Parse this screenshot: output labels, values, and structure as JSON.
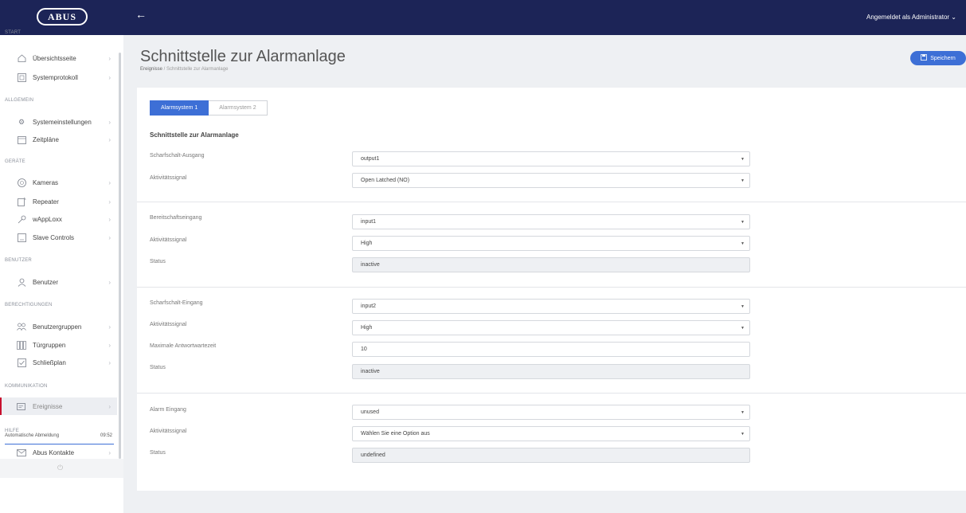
{
  "header": {
    "logo_text": "ABUS",
    "user_label": "Angemeldet als Administrator",
    "back_icon": "arrow-left-icon"
  },
  "sidebar": {
    "sections": {
      "start": "START",
      "allgemein": "ALLGEMEIN",
      "geraete": "GERÄTE",
      "benutzer": "BENUTZER",
      "berechtigungen": "BERECHTIGUNGEN",
      "kommunikation": "KOMMUNIKATION",
      "hilfe": "HILFE"
    },
    "items": {
      "uebersicht": "Übersichtsseite",
      "systemprotokoll": "Systemprotokoll",
      "systemeinstellungen": "Systemeinstellungen",
      "zeitplaene": "Zeitpläne",
      "kameras": "Kameras",
      "repeater": "Repeater",
      "wapploxx": "wAppLoxx",
      "slave_controls": "Slave Controls",
      "benutzer": "Benutzer",
      "benutzergruppen": "Benutzergruppen",
      "tuergruppen": "Türgruppen",
      "schliessplan": "Schließplan",
      "ereignisse": "Ereignisse",
      "abus_kontakte": "Abus Kontakte"
    },
    "autologout": {
      "label": "Automatische Abmeldung",
      "time": "09:52"
    }
  },
  "page": {
    "title": "Schnittstelle zur Alarmanlage",
    "breadcrumb_root": "Ereignisse",
    "breadcrumb_sep": " / ",
    "breadcrumb_current": "Schnittstelle zur Alarmanlage",
    "save_label": "Speichern"
  },
  "tabs": [
    "Alarmsystem 1",
    "Alarmsystem 2"
  ],
  "section_title": "Schnittstelle zur Alarmanlage",
  "groups": [
    {
      "label1": "Scharfschalt-Ausgang",
      "value1": "output1",
      "label2": "Aktivitätssignal",
      "value2": "Open Latched (NO)"
    },
    {
      "label1": "Bereitschaftseingang",
      "value1": "input1",
      "label2": "Aktivitätssignal",
      "value2": "High",
      "label3": "Status",
      "value3": "inactive"
    },
    {
      "label1": "Scharfschalt-Eingang",
      "value1": "input2",
      "label2": "Aktivitätssignal",
      "value2": "High",
      "label3": "Maximale Antwortwartezeit",
      "value3": "10",
      "label4": "Status",
      "value4": "inactive"
    },
    {
      "label1": "Alarm Eingang",
      "value1": "unused",
      "label2": "Aktivitätssignal",
      "value2": "Wählen Sie eine Option aus",
      "label3": "Status",
      "value3": "undefined"
    }
  ],
  "colors": {
    "topbar": "#1c2457",
    "accent": "#3d6fd6",
    "active_marker": "#c8102e"
  }
}
